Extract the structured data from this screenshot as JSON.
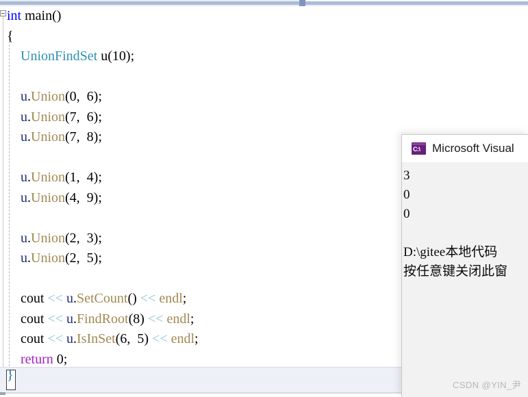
{
  "editor": {
    "outline_marker": "−",
    "lines": [
      {
        "indent": 0,
        "tokens": [
          {
            "t": "int",
            "c": "kw"
          },
          {
            "t": " ",
            "c": "punc"
          },
          {
            "t": "main",
            "c": "ident"
          },
          {
            "t": "()",
            "c": "punc"
          }
        ]
      },
      {
        "indent": 0,
        "tokens": [
          {
            "t": "{",
            "c": "punc"
          }
        ]
      },
      {
        "indent": 1,
        "tokens": [
          {
            "t": "UnionFindSet",
            "c": "type"
          },
          {
            "t": " ",
            "c": "punc"
          },
          {
            "t": "u",
            "c": "ident"
          },
          {
            "t": "(",
            "c": "punc"
          },
          {
            "t": "10",
            "c": "num"
          },
          {
            "t": ");",
            "c": "punc"
          }
        ]
      },
      {
        "indent": 1,
        "tokens": []
      },
      {
        "indent": 1,
        "tokens": [
          {
            "t": "u",
            "c": "obj"
          },
          {
            "t": ".",
            "c": "punc"
          },
          {
            "t": "Union",
            "c": "meth"
          },
          {
            "t": "(",
            "c": "punc"
          },
          {
            "t": "0",
            "c": "num"
          },
          {
            "t": ",  ",
            "c": "punc"
          },
          {
            "t": "6",
            "c": "num"
          },
          {
            "t": ");",
            "c": "punc"
          }
        ]
      },
      {
        "indent": 1,
        "tokens": [
          {
            "t": "u",
            "c": "obj"
          },
          {
            "t": ".",
            "c": "punc"
          },
          {
            "t": "Union",
            "c": "meth"
          },
          {
            "t": "(",
            "c": "punc"
          },
          {
            "t": "7",
            "c": "num"
          },
          {
            "t": ",  ",
            "c": "punc"
          },
          {
            "t": "6",
            "c": "num"
          },
          {
            "t": ");",
            "c": "punc"
          }
        ]
      },
      {
        "indent": 1,
        "tokens": [
          {
            "t": "u",
            "c": "obj"
          },
          {
            "t": ".",
            "c": "punc"
          },
          {
            "t": "Union",
            "c": "meth"
          },
          {
            "t": "(",
            "c": "punc"
          },
          {
            "t": "7",
            "c": "num"
          },
          {
            "t": ",  ",
            "c": "punc"
          },
          {
            "t": "8",
            "c": "num"
          },
          {
            "t": ");",
            "c": "punc"
          }
        ]
      },
      {
        "indent": 1,
        "tokens": []
      },
      {
        "indent": 1,
        "tokens": [
          {
            "t": "u",
            "c": "obj"
          },
          {
            "t": ".",
            "c": "punc"
          },
          {
            "t": "Union",
            "c": "meth"
          },
          {
            "t": "(",
            "c": "punc"
          },
          {
            "t": "1",
            "c": "num"
          },
          {
            "t": ",  ",
            "c": "punc"
          },
          {
            "t": "4",
            "c": "num"
          },
          {
            "t": ");",
            "c": "punc"
          }
        ]
      },
      {
        "indent": 1,
        "tokens": [
          {
            "t": "u",
            "c": "obj"
          },
          {
            "t": ".",
            "c": "punc"
          },
          {
            "t": "Union",
            "c": "meth"
          },
          {
            "t": "(",
            "c": "punc"
          },
          {
            "t": "4",
            "c": "num"
          },
          {
            "t": ",  ",
            "c": "punc"
          },
          {
            "t": "9",
            "c": "num"
          },
          {
            "t": ");",
            "c": "punc"
          }
        ]
      },
      {
        "indent": 1,
        "tokens": []
      },
      {
        "indent": 1,
        "tokens": [
          {
            "t": "u",
            "c": "obj"
          },
          {
            "t": ".",
            "c": "punc"
          },
          {
            "t": "Union",
            "c": "meth"
          },
          {
            "t": "(",
            "c": "punc"
          },
          {
            "t": "2",
            "c": "num"
          },
          {
            "t": ",  ",
            "c": "punc"
          },
          {
            "t": "3",
            "c": "num"
          },
          {
            "t": ");",
            "c": "punc"
          }
        ]
      },
      {
        "indent": 1,
        "tokens": [
          {
            "t": "u",
            "c": "obj"
          },
          {
            "t": ".",
            "c": "punc"
          },
          {
            "t": "Union",
            "c": "meth"
          },
          {
            "t": "(",
            "c": "punc"
          },
          {
            "t": "2",
            "c": "num"
          },
          {
            "t": ",  ",
            "c": "punc"
          },
          {
            "t": "5",
            "c": "num"
          },
          {
            "t": ");",
            "c": "punc"
          }
        ]
      },
      {
        "indent": 1,
        "tokens": []
      },
      {
        "indent": 1,
        "tokens": [
          {
            "t": "cout",
            "c": "ident"
          },
          {
            "t": " ",
            "c": "punc"
          },
          {
            "t": "<<",
            "c": "op"
          },
          {
            "t": " ",
            "c": "punc"
          },
          {
            "t": "u",
            "c": "obj"
          },
          {
            "t": ".",
            "c": "punc"
          },
          {
            "t": "SetCount",
            "c": "meth"
          },
          {
            "t": "()",
            "c": "punc"
          },
          {
            "t": " ",
            "c": "punc"
          },
          {
            "t": "<<",
            "c": "op"
          },
          {
            "t": " ",
            "c": "punc"
          },
          {
            "t": "endl",
            "c": "strm"
          },
          {
            "t": ";",
            "c": "punc"
          }
        ]
      },
      {
        "indent": 1,
        "tokens": [
          {
            "t": "cout",
            "c": "ident"
          },
          {
            "t": " ",
            "c": "punc"
          },
          {
            "t": "<<",
            "c": "op"
          },
          {
            "t": " ",
            "c": "punc"
          },
          {
            "t": "u",
            "c": "obj"
          },
          {
            "t": ".",
            "c": "punc"
          },
          {
            "t": "FindRoot",
            "c": "meth"
          },
          {
            "t": "(",
            "c": "punc"
          },
          {
            "t": "8",
            "c": "num"
          },
          {
            "t": ")",
            "c": "punc"
          },
          {
            "t": " ",
            "c": "punc"
          },
          {
            "t": "<<",
            "c": "op"
          },
          {
            "t": " ",
            "c": "punc"
          },
          {
            "t": "endl",
            "c": "strm"
          },
          {
            "t": ";",
            "c": "punc"
          }
        ]
      },
      {
        "indent": 1,
        "tokens": [
          {
            "t": "cout",
            "c": "ident"
          },
          {
            "t": " ",
            "c": "punc"
          },
          {
            "t": "<<",
            "c": "op"
          },
          {
            "t": " ",
            "c": "punc"
          },
          {
            "t": "u",
            "c": "obj"
          },
          {
            "t": ".",
            "c": "punc"
          },
          {
            "t": "IsInSet",
            "c": "meth"
          },
          {
            "t": "(",
            "c": "punc"
          },
          {
            "t": "6",
            "c": "num"
          },
          {
            "t": ",  ",
            "c": "punc"
          },
          {
            "t": "5",
            "c": "num"
          },
          {
            "t": ")",
            "c": "punc"
          },
          {
            "t": " ",
            "c": "punc"
          },
          {
            "t": "<<",
            "c": "op"
          },
          {
            "t": " ",
            "c": "punc"
          },
          {
            "t": "endl",
            "c": "strm"
          },
          {
            "t": ";",
            "c": "punc"
          }
        ]
      },
      {
        "indent": 1,
        "tokens": [
          {
            "t": "return",
            "c": "kw2"
          },
          {
            "t": " ",
            "c": "punc"
          },
          {
            "t": "0",
            "c": "num"
          },
          {
            "t": ";",
            "c": "punc"
          }
        ]
      }
    ],
    "closing_brace": "}"
  },
  "console": {
    "title": "Microsoft Visual",
    "icon": "console-cmd-icon",
    "icon_label": "C:\\",
    "output_lines": [
      "3",
      "0",
      "0",
      "",
      "D:\\gitee本地代码",
      "按任意键关闭此窗"
    ]
  },
  "watermark": {
    "text": "CSDN @YIN_尹"
  },
  "colors": {
    "keyword": "#0000ff",
    "keyword_control": "#a020c0",
    "type": "#2b91af",
    "member": "#a08a52",
    "operator": "#8fc3cf",
    "receiver": "#1f2d7a",
    "console_icon": "#68217a",
    "splitter": "#a9bcd8"
  }
}
